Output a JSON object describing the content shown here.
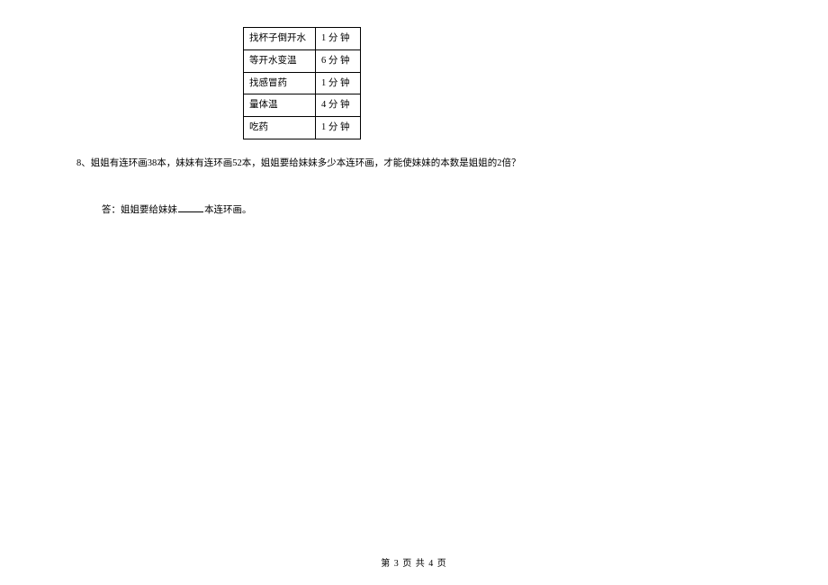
{
  "table": {
    "rows": [
      {
        "task": "找杯子倒开水",
        "time": "1 分 钟"
      },
      {
        "task": "等开水变温",
        "time": "6 分 钟"
      },
      {
        "task": "找感冒药",
        "time": "1 分 钟"
      },
      {
        "task": "量体温",
        "time": "4 分 钟"
      },
      {
        "task": "吃药",
        "time": "1 分 钟"
      }
    ]
  },
  "question8": {
    "number": "8、",
    "text": "姐姐有连环画38本，妹妹有连环画52本，姐姐要给妹妹多少本连环画，才能使妹妹的本数是姐姐的2倍？",
    "answer_prefix": "答：姐姐要给妹妹",
    "answer_suffix": "本连环画。"
  },
  "footer": {
    "text": "第 3 页 共 4 页"
  }
}
